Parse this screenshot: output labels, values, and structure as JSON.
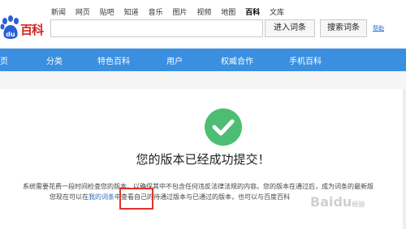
{
  "logo": {
    "text": "百科"
  },
  "topnav": [
    "新闻",
    "网页",
    "贴吧",
    "知道",
    "音乐",
    "图片",
    "视频",
    "地图",
    "百科",
    "文库"
  ],
  "topnav_active": "百科",
  "search": {
    "placeholder": "",
    "enter_label": "进入词条",
    "search_label": "搜索词条",
    "help_label": "帮助"
  },
  "mainnav": [
    "页",
    "分类",
    "特色百科",
    "用户",
    "权威合作",
    "手机百科"
  ],
  "success": {
    "title": "您的版本已经成功提交！"
  },
  "message": {
    "line1": "系统需要花费一段时间检查您的版本，以确保其中不包含任何违反法律法规的内容。您的版本在通过后，成为词条的最新版",
    "line2_before": "您现在可以在",
    "line2_link": "我的词条",
    "line2_after": "中查看自己的待通过版本与已通过的版本，也可以与百度百科"
  },
  "watermark": {
    "main": "Baidu",
    "sub": "经验"
  },
  "colors": {
    "nav": "#3b8fe0",
    "check": "#4dbd74",
    "link": "#2a6bc5",
    "highlight": "#e0332d"
  }
}
